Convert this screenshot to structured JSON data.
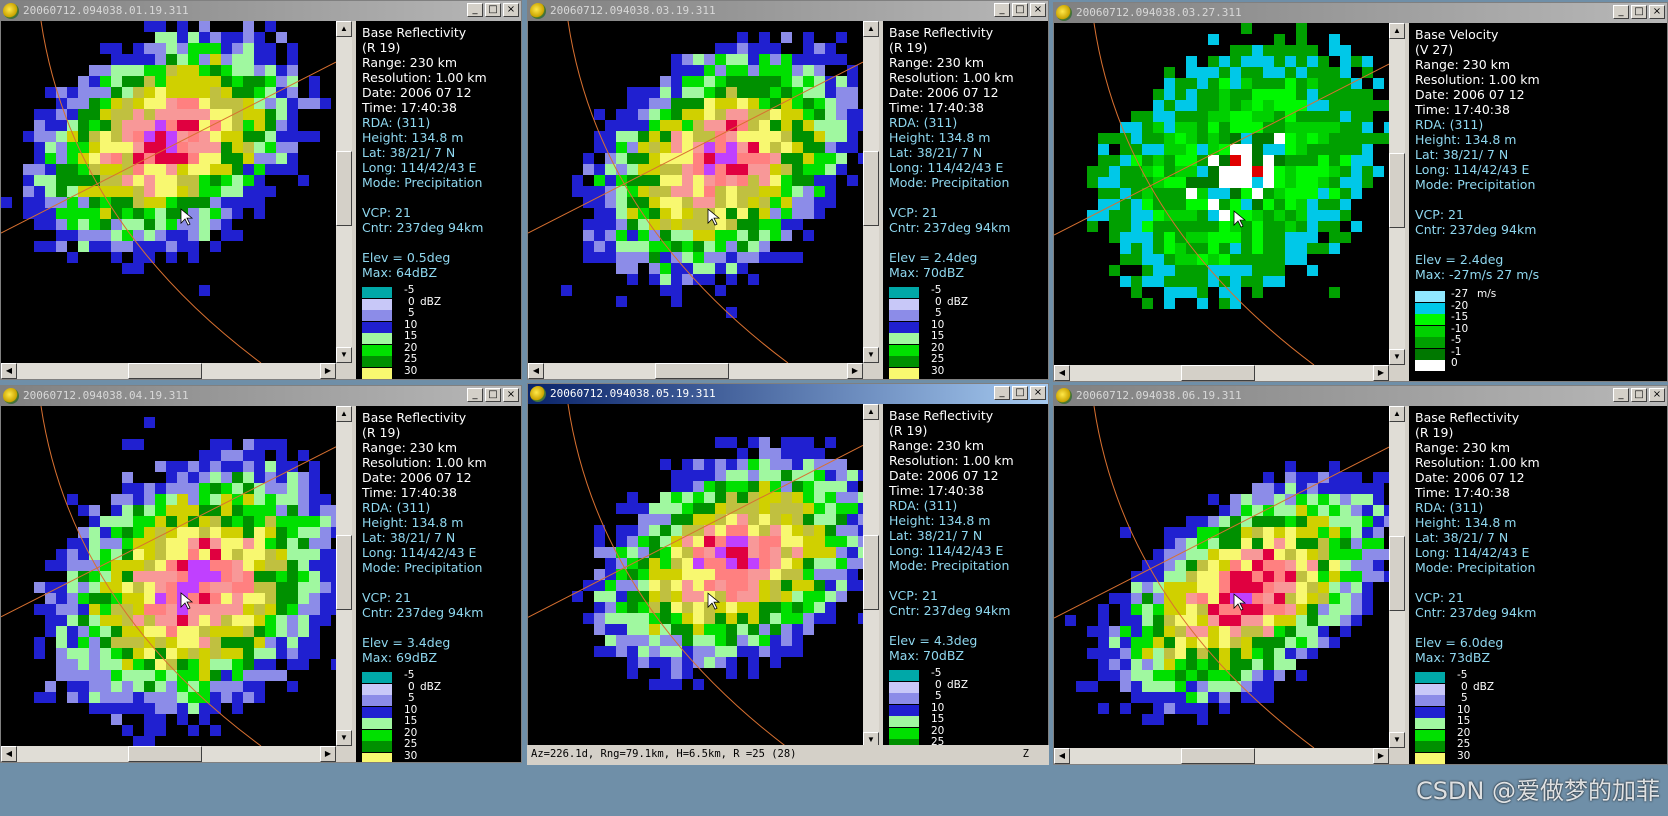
{
  "windows": [
    {
      "title": "20060712.094038.01.19.311",
      "active": false,
      "product": "Base Reflectivity",
      "code": "(R 19)",
      "range": "Range: 230 km",
      "resolution": "Resolution: 1.00 km",
      "date": "Date: 2006 07 12",
      "time": "Time: 17:40:38",
      "rda": "RDA:  (311)",
      "height": "Height: 134.8 m",
      "lat": "Lat:  38/21/ 7 N",
      "long": "Long: 114/42/43 E",
      "mode": "Mode: Precipitation",
      "vcp": "VCP: 21",
      "cntr": "Cntr: 237deg  94km",
      "elev": "Elev = 0.5deg",
      "max": "Max: 64dBZ",
      "legend_type": "refl"
    },
    {
      "title": "20060712.094038.03.19.311",
      "active": false,
      "product": "Base Reflectivity",
      "code": "(R 19)",
      "range": "Range: 230 km",
      "resolution": "Resolution: 1.00 km",
      "date": "Date: 2006 07 12",
      "time": "Time: 17:40:38",
      "rda": "RDA:  (311)",
      "height": "Height: 134.8 m",
      "lat": "Lat:  38/21/ 7 N",
      "long": "Long: 114/42/43 E",
      "mode": "Mode: Precipitation",
      "vcp": "VCP: 21",
      "cntr": "Cntr: 237deg  94km",
      "elev": "Elev = 2.4deg",
      "max": "Max: 70dBZ",
      "legend_type": "refl"
    },
    {
      "title": "20060712.094038.03.27.311",
      "active": false,
      "product": "Base Velocity",
      "code": "(V 27)",
      "range": "Range: 230 km",
      "resolution": "Resolution: 1.00 km",
      "date": "Date: 2006 07 12",
      "time": "Time: 17:40:38",
      "rda": "RDA:  (311)",
      "height": "Height: 134.8 m",
      "lat": "Lat:  38/21/ 7 N",
      "long": "Long: 114/42/43 E",
      "mode": "Mode: Precipitation",
      "vcp": "VCP: 21",
      "cntr": "Cntr: 237deg  94km",
      "elev": "Elev = 2.4deg",
      "max": "Max: -27m/s  27 m/s",
      "legend_type": "vel"
    },
    {
      "title": "20060712.094038.04.19.311",
      "active": false,
      "product": "Base Reflectivity",
      "code": "(R 19)",
      "range": "Range: 230 km",
      "resolution": "Resolution: 1.00 km",
      "date": "Date: 2006 07 12",
      "time": "Time: 17:40:38",
      "rda": "RDA:  (311)",
      "height": "Height: 134.8 m",
      "lat": "Lat:  38/21/ 7 N",
      "long": "Long: 114/42/43 E",
      "mode": "Mode: Precipitation",
      "vcp": "VCP: 21",
      "cntr": "Cntr: 237deg  94km",
      "elev": "Elev = 3.4deg",
      "max": "Max: 69dBZ",
      "legend_type": "refl"
    },
    {
      "title": "20060712.094038.05.19.311",
      "active": true,
      "product": "Base Reflectivity",
      "code": "(R 19)",
      "range": "Range: 230 km",
      "resolution": "Resolution: 1.00 km",
      "date": "Date: 2006 07 12",
      "time": "Time: 17:40:38",
      "rda": "RDA:  (311)",
      "height": "Height: 134.8 m",
      "lat": "Lat:  38/21/ 7 N",
      "long": "Long: 114/42/43 E",
      "mode": "Mode: Precipitation",
      "vcp": "VCP: 21",
      "cntr": "Cntr: 237deg  94km",
      "elev": "Elev = 4.3deg",
      "max": "Max: 70dBZ",
      "legend_type": "refl"
    },
    {
      "title": "20060712.094038.06.19.311",
      "active": false,
      "product": "Base Reflectivity",
      "code": "(R 19)",
      "range": "Range: 230 km",
      "resolution": "Resolution: 1.00 km",
      "date": "Date: 2006 07 12",
      "time": "Time: 17:40:38",
      "rda": "RDA:  (311)",
      "height": "Height: 134.8 m",
      "lat": "Lat:  38/21/ 7 N",
      "long": "Long: 114/42/43 E",
      "mode": "Mode: Precipitation",
      "vcp": "VCP: 21",
      "cntr": "Cntr: 237deg  94km",
      "elev": "Elev = 6.0deg",
      "max": "Max: 73dBZ",
      "legend_type": "refl"
    }
  ],
  "legends": {
    "refl": {
      "unit": "dBZ",
      "entries": [
        {
          "label": "-5",
          "color": "#00a8a8"
        },
        {
          "label": "0",
          "color": "#c8c8f8"
        },
        {
          "label": "5",
          "color": "#8c8ce8"
        },
        {
          "label": "10",
          "color": "#2020d0"
        },
        {
          "label": "15",
          "color": "#a0f8a0"
        },
        {
          "label": "20",
          "color": "#00e000"
        },
        {
          "label": "25",
          "color": "#009000"
        },
        {
          "label": "30",
          "color": "#f8f870"
        }
      ]
    },
    "vel": {
      "unit": "m/s",
      "entries": [
        {
          "label": "-27",
          "color": "#90e8ff"
        },
        {
          "label": "-20",
          "color": "#00c8e8"
        },
        {
          "label": "-15",
          "color": "#00f800"
        },
        {
          "label": "-10",
          "color": "#00d000"
        },
        {
          "label": "-5",
          "color": "#00a000"
        },
        {
          "label": "-1",
          "color": "#007800"
        },
        {
          "label": "0",
          "color": "#ffffff"
        }
      ]
    }
  },
  "status_bar": {
    "text": "Az=226.1d, Rng=79.1km, H=6.5km,  R =25  (28)",
    "indicator": "Z"
  },
  "window_buttons": {
    "minimize": "_",
    "maximize": "□",
    "close": "×"
  },
  "watermark": "CSDN @爱做梦的加菲",
  "icons": {
    "app": "radar-app-icon",
    "cursor": "mouse-cursor-icon"
  }
}
